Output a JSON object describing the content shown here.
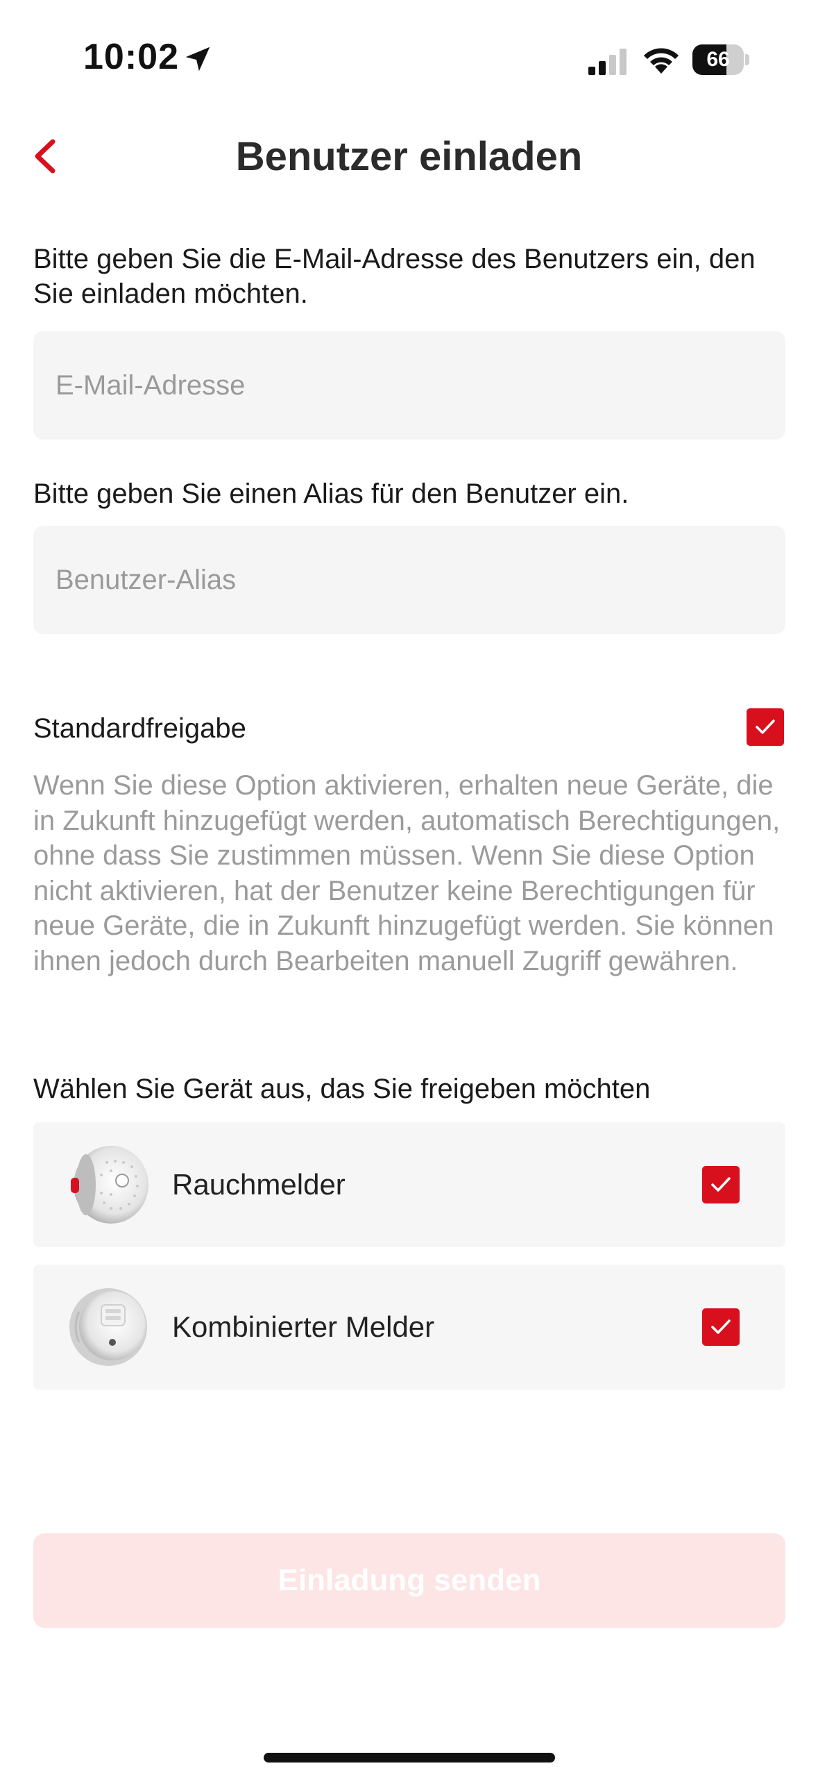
{
  "status_bar": {
    "time": "10:02",
    "battery_level": "66",
    "battery_fraction": 0.66,
    "icons": [
      "location-arrow-icon",
      "cellular-signal-icon",
      "wifi-icon",
      "battery-icon"
    ]
  },
  "nav": {
    "title": "Benutzer einladen",
    "back_icon": "chevron-left-icon",
    "accent_color": "#d8101d"
  },
  "email": {
    "label": "Bitte geben Sie die E-Mail-Adresse des Benutzers ein, den Sie einladen möchten.",
    "placeholder": "E-Mail-Adresse",
    "value": ""
  },
  "alias": {
    "label": "Bitte geben Sie einen Alias für den Benutzer ein.",
    "placeholder": "Benutzer-Alias",
    "value": ""
  },
  "default_share": {
    "label": "Standardfreigabe",
    "checked": true,
    "description": "Wenn Sie diese Option aktivieren, erhalten neue Geräte, die in Zukunft hinzugefügt werden, automatisch Berechtigungen, ohne dass Sie zustimmen müssen. Wenn Sie diese Option nicht aktivieren, hat der Benutzer keine Berechtigungen für neue Geräte, die in Zukunft hinzugefügt werden. Sie können ihnen jedoch durch Bearbeiten manuell Zugriff gewähren."
  },
  "devices": {
    "label": "Wählen Sie Gerät aus, das Sie freigeben möchten",
    "items": [
      {
        "name": "Rauchmelder",
        "checked": true,
        "icon": "smoke-detector-image"
      },
      {
        "name": "Kombinierter Melder",
        "checked": true,
        "icon": "combined-detector-image"
      }
    ]
  },
  "send_button": {
    "label": "Einladung senden",
    "enabled": false
  }
}
